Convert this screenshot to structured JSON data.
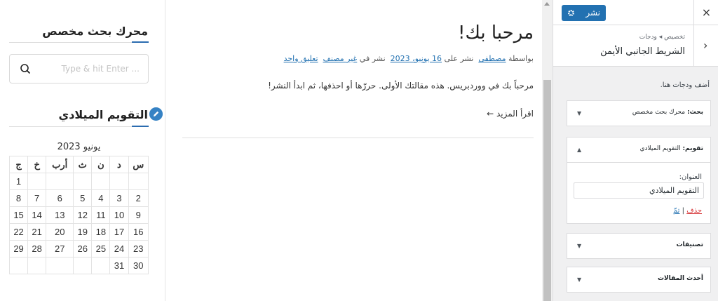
{
  "preview": {
    "search_widget": {
      "title": "محرك بحث مخصص",
      "placeholder": "Type & hit Enter ..."
    },
    "calendar_widget": {
      "title": "التقويم الميلادي",
      "caption": "يونيو 2023",
      "weekdays": [
        "س",
        "د",
        "ن",
        "ث",
        "أرب",
        "خ",
        "ج"
      ],
      "rows": [
        [
          "",
          "",
          "",
          "",
          "",
          "",
          "1"
        ],
        [
          "2",
          "3",
          "4",
          "5",
          "6",
          "7",
          "8"
        ],
        [
          "9",
          "10",
          "11",
          "12",
          "13",
          "14",
          "15"
        ],
        [
          "16",
          "17",
          "18",
          "19",
          "20",
          "21",
          "22"
        ],
        [
          "23",
          "24",
          "25",
          "26",
          "27",
          "28",
          "29"
        ],
        [
          "30",
          "31",
          "",
          "",
          "",
          "",
          ""
        ]
      ]
    },
    "post": {
      "title": "مرحبا بك!",
      "meta_by": "بواسطة",
      "author": "مصطفى",
      "published_on": "نشر على",
      "date": "16 يونيو، 2023",
      "posted_in": "نشر في",
      "category": "غير مصنف",
      "comment": "تعليق واحد",
      "excerpt": "مرحباً بك في ووردبريس. هذه مقالتك الأولى. حررّها أو احذفها، ثم ابدأ النشر!",
      "read_more": "اقرأ المزيد ←"
    }
  },
  "customizer": {
    "close": "×",
    "publish_label": "نشر",
    "back": "›",
    "breadcrumb": "تخصيص ◂ ودجات",
    "section_title": "الشريط الجانبي الأيمن",
    "description": "أضف ودجات هنا.",
    "widgets": [
      {
        "type": "بحث:",
        "name": "محرك بحث مخصص",
        "arrow": "▼"
      },
      {
        "type": "تقويم:",
        "name": "التقويم الميلادي",
        "arrow": "▲"
      },
      {
        "type": "",
        "name": "تصنيفات",
        "arrow": "▼"
      },
      {
        "type": "",
        "name": "أحدث المقالات",
        "arrow": "▼"
      }
    ],
    "title_field": {
      "label": "العنوان:",
      "value": "التقويم الميلادي"
    },
    "delete_label": "حذف",
    "separator": "|",
    "done_label": "تمّ"
  },
  "colors": {
    "accent": "#2271b1",
    "delete": "#d63638",
    "panel_bg": "#f0f0f1"
  }
}
